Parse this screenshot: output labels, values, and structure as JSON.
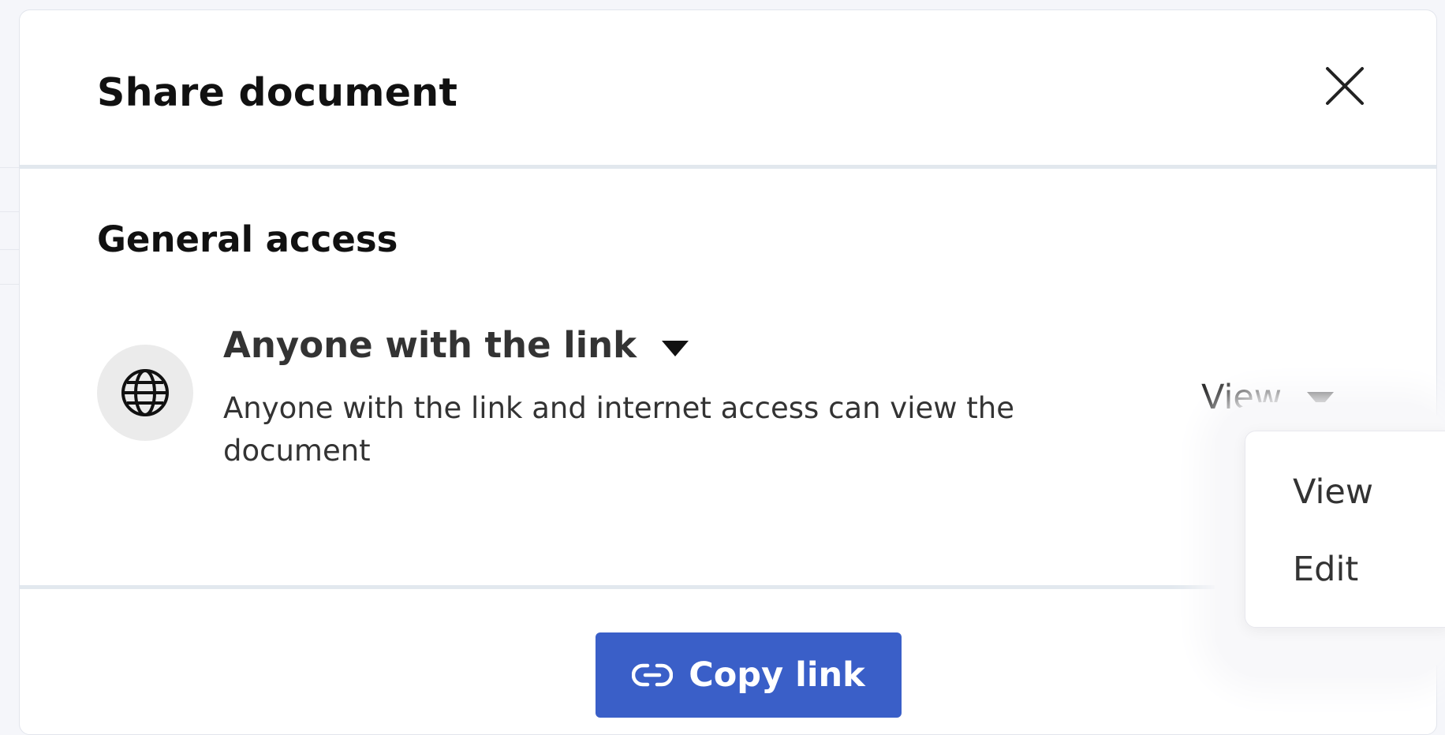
{
  "modal": {
    "title": "Share document",
    "close_icon": "close-icon"
  },
  "general_access": {
    "heading": "General access",
    "icon": "globe-icon",
    "access_option": "Anyone with the link",
    "description": "Anyone with the link and internet access can view the document",
    "permission_value": "View",
    "permission_options": [
      "View",
      "Edit"
    ]
  },
  "footer": {
    "copy_label": "Copy link",
    "copy_icon": "link-icon"
  },
  "colors": {
    "accent": "#3a5fc8",
    "divider": "#e2e8ee",
    "icon_circle": "#ebebeb"
  }
}
